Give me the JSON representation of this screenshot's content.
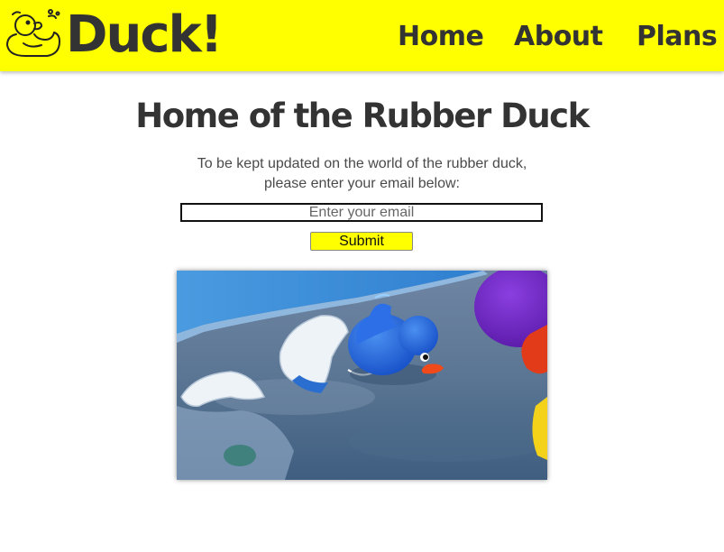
{
  "header": {
    "brand": "Duck!",
    "logo_icon": "rubber-duck-outline-icon",
    "nav": [
      {
        "label": "Home"
      },
      {
        "label": "About"
      },
      {
        "label": "Plans"
      }
    ],
    "background_color": "#ffff00"
  },
  "main": {
    "title": "Home of the Rubber Duck",
    "intro_line_1": "To be kept updated on the world of the rubber duck,",
    "intro_line_2": "please enter your email below:",
    "email_placeholder": "Enter your email",
    "submit_label": "Submit",
    "submit_color": "#ffff00"
  }
}
